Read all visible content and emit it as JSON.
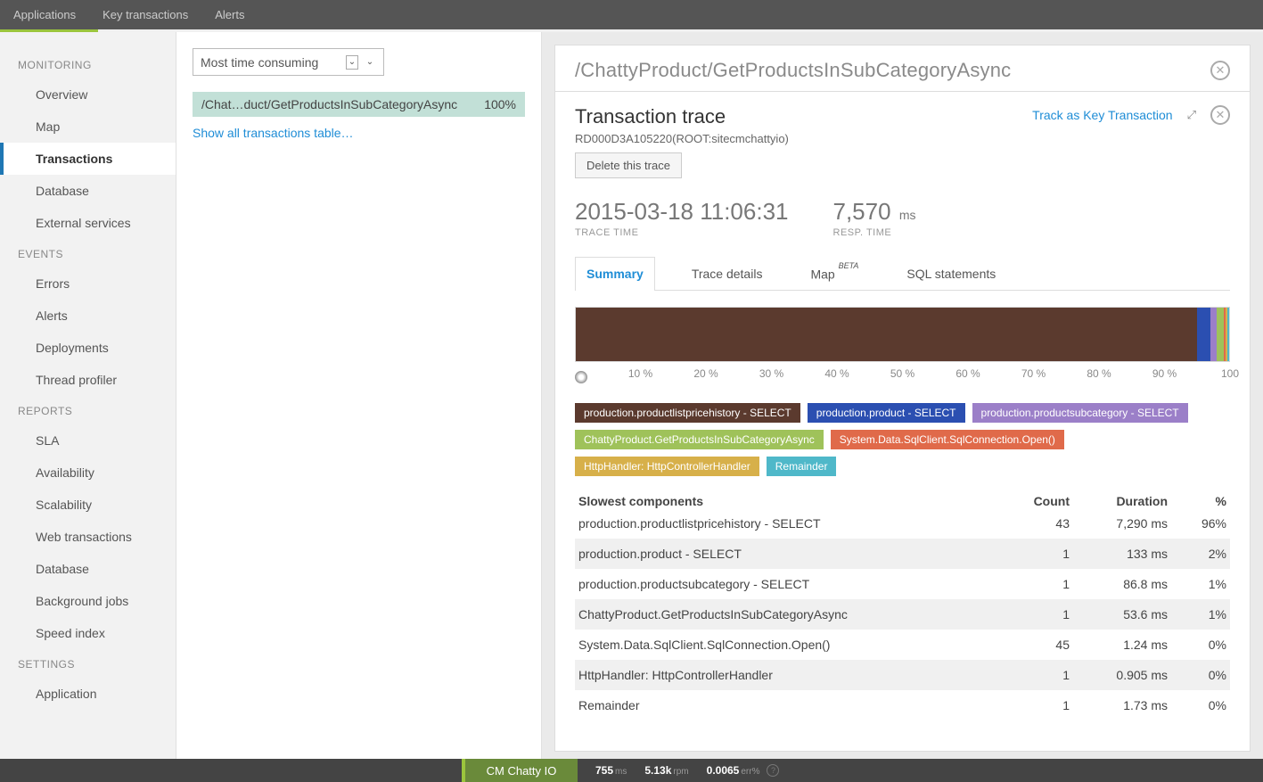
{
  "topnav": {
    "applications": "Applications",
    "key_transactions": "Key transactions",
    "alerts": "Alerts"
  },
  "sidebar": {
    "monitoring": {
      "heading": "MONITORING",
      "items": [
        "Overview",
        "Map",
        "Transactions",
        "Database",
        "External services"
      ]
    },
    "events": {
      "heading": "EVENTS",
      "items": [
        "Errors",
        "Alerts",
        "Deployments",
        "Thread profiler"
      ]
    },
    "reports": {
      "heading": "REPORTS",
      "items": [
        "SLA",
        "Availability",
        "Scalability",
        "Web transactions",
        "Database",
        "Background jobs",
        "Speed index"
      ]
    },
    "settings": {
      "heading": "SETTINGS",
      "items": [
        "Application"
      ]
    }
  },
  "contentcol": {
    "dropdown": "Most time consuming",
    "txn_name": "/Chat…duct/GetProductsInSubCategoryAsync",
    "txn_pct": "100%",
    "show_all": "Show all transactions table…"
  },
  "panel": {
    "title": "/ChattyProduct/GetProductsInSubCategoryAsync",
    "trace_heading": "Transaction trace",
    "track_key": "Track as Key Transaction",
    "subtitle": "RD000D3A105220(ROOT:sitecmchattyio)",
    "delete": "Delete this trace",
    "trace_time": "2015-03-18 11:06:31",
    "trace_time_lbl": "TRACE TIME",
    "resp_time": "7,570",
    "resp_time_unit": "ms",
    "resp_time_lbl": "RESP. TIME",
    "tabs": {
      "summary": "Summary",
      "trace_details": "Trace details",
      "map": "Map",
      "map_beta": "BETA",
      "sql": "SQL statements"
    },
    "legend": [
      {
        "label": "production.productlistpricehistory - SELECT",
        "color": "#5b3a2e"
      },
      {
        "label": "production.product - SELECT",
        "color": "#2b4fb1"
      },
      {
        "label": "production.productsubcategory - SELECT",
        "color": "#9b7fc8"
      },
      {
        "label": "ChattyProduct.GetProductsInSubCategoryAsync",
        "color": "#9fc25a"
      },
      {
        "label": "System.Data.SqlClient.SqlConnection.Open()",
        "color": "#e06a4a"
      },
      {
        "label": "HttpHandler: HttpControllerHandler",
        "color": "#d7b04a"
      },
      {
        "label": "Remainder",
        "color": "#4fb8c9"
      }
    ],
    "axis_ticks": [
      "10 %",
      "20 %",
      "30 %",
      "40 %",
      "50 %",
      "60 %",
      "70 %",
      "80 %",
      "90 %",
      "100"
    ],
    "table": {
      "header": {
        "name": "Slowest components",
        "count": "Count",
        "duration": "Duration",
        "pct": "%"
      },
      "rows": [
        {
          "name": "production.productlistpricehistory - SELECT",
          "count": "43",
          "duration": "7,290 ms",
          "pct": "96%"
        },
        {
          "name": "production.product - SELECT",
          "count": "1",
          "duration": "133 ms",
          "pct": "2%"
        },
        {
          "name": "production.productsubcategory - SELECT",
          "count": "1",
          "duration": "86.8 ms",
          "pct": "1%"
        },
        {
          "name": "ChattyProduct.GetProductsInSubCategoryAsync",
          "count": "1",
          "duration": "53.6 ms",
          "pct": "1%"
        },
        {
          "name": "System.Data.SqlClient.SqlConnection.Open()",
          "count": "45",
          "duration": "1.24 ms",
          "pct": "0%"
        },
        {
          "name": "HttpHandler: HttpControllerHandler",
          "count": "1",
          "duration": "0.905 ms",
          "pct": "0%"
        },
        {
          "name": "Remainder",
          "count": "1",
          "duration": "1.73 ms",
          "pct": "0%"
        }
      ]
    }
  },
  "chart_data": {
    "type": "bar",
    "orientation": "horizontal-stacked",
    "unit": "%",
    "series": [
      {
        "name": "production.productlistpricehistory - SELECT",
        "value": 96,
        "color": "#5b3a2e"
      },
      {
        "name": "production.product - SELECT",
        "value": 2,
        "color": "#2b4fb1"
      },
      {
        "name": "production.productsubcategory - SELECT",
        "value": 1,
        "color": "#9b7fc8"
      },
      {
        "name": "ChattyProduct.GetProductsInSubCategoryAsync",
        "value": 1,
        "color": "#9fc25a"
      },
      {
        "name": "System.Data.SqlClient.SqlConnection.Open()",
        "value": 0,
        "color": "#e06a4a"
      },
      {
        "name": "HttpHandler: HttpControllerHandler",
        "value": 0,
        "color": "#d7b04a"
      },
      {
        "name": "Remainder",
        "value": 0,
        "color": "#4fb8c9"
      }
    ],
    "xlim": [
      0,
      100
    ],
    "xticks": [
      10,
      20,
      30,
      40,
      50,
      60,
      70,
      80,
      90,
      100
    ]
  },
  "footer": {
    "app": "CM Chatty IO",
    "m1": "755",
    "m1u": "ms",
    "m2": "5.13k",
    "m2u": "rpm",
    "m3": "0.0065",
    "m3u": "err%"
  }
}
